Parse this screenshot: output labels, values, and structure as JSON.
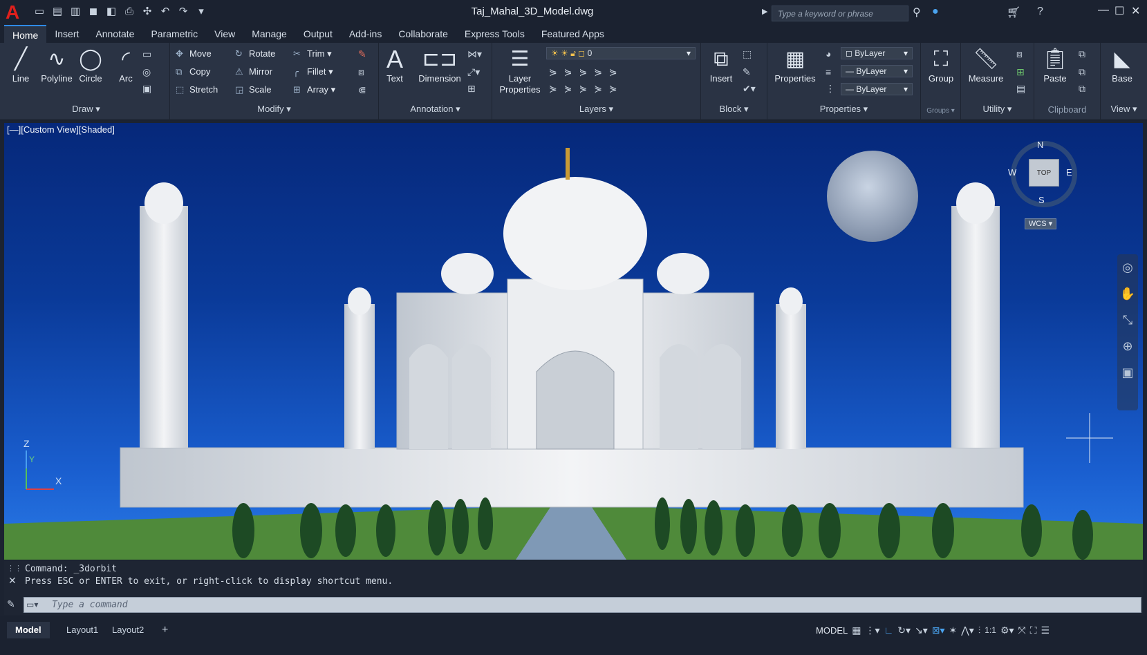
{
  "app": {
    "title": "Taj_Mahal_3D_Model.dwg",
    "logo": "A"
  },
  "search": {
    "placeholder": "Type a keyword or phrase"
  },
  "tabs": [
    "Home",
    "Insert",
    "Annotate",
    "Parametric",
    "View",
    "Manage",
    "Output",
    "Add-ins",
    "Collaborate",
    "Express Tools",
    "Featured Apps"
  ],
  "draw": {
    "title": "Draw",
    "line": "Line",
    "polyline": "Polyline",
    "circle": "Circle",
    "arc": "Arc"
  },
  "modify": {
    "title": "Modify",
    "move": "Move",
    "rotate": "Rotate",
    "trim": "Trim",
    "copy": "Copy",
    "mirror": "Mirror",
    "fillet": "Fillet",
    "stretch": "Stretch",
    "scale": "Scale",
    "array": "Array"
  },
  "annotation": {
    "title": "Annotation",
    "text": "Text",
    "dimension": "Dimension"
  },
  "layers": {
    "title": "Layers",
    "layer_properties": "Layer Properties",
    "current": "0"
  },
  "block": {
    "title": "Block",
    "insert": "Insert"
  },
  "properties": {
    "title": "Properties",
    "label": "Properties",
    "color": "ByLayer",
    "linetype": "ByLayer",
    "lineweight": "ByLayer"
  },
  "groups": {
    "title": "Groups",
    "group": "Group"
  },
  "utility": {
    "title": "Utility",
    "measure": "Measure"
  },
  "clipboard": {
    "title": "Clipboard",
    "paste": "Paste"
  },
  "view": {
    "title": "View",
    "base": "Base"
  },
  "viewport": {
    "label": "[—][Custom View][Shaded]",
    "viewcube": {
      "n": "N",
      "s": "S",
      "e": "E",
      "w": "W",
      "face": "TOP",
      "wcs": "WCS"
    },
    "ucs": {
      "x": "X",
      "y": "Y",
      "z": "Z"
    }
  },
  "command": {
    "line1": "Command: _3dorbit",
    "line2": "Press ESC or ENTER to exit, or right-click to display shortcut menu.",
    "placeholder": "Type a command"
  },
  "layouts": [
    "Model",
    "Layout1",
    "Layout2"
  ],
  "status": {
    "model": "MODEL",
    "scale": "1:1"
  }
}
